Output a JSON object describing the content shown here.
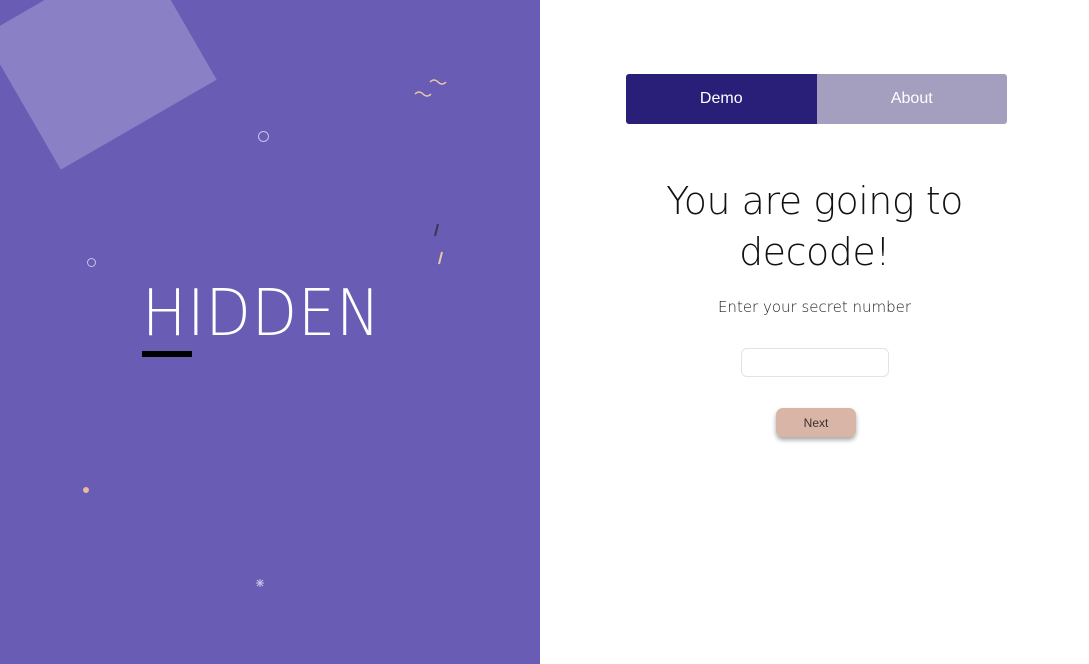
{
  "brand": {
    "title": "HIDDEN"
  },
  "tabs": [
    {
      "label": "Demo",
      "active": true
    },
    {
      "label": "About",
      "active": false
    }
  ],
  "main": {
    "heading_line1": "You are going to",
    "heading_line2": "decode!",
    "subtitle": "Enter your secret number",
    "secret_input_value": "",
    "secret_input_placeholder": "",
    "next_label": "Next"
  },
  "colors": {
    "left_panel_bg": "#685cb5",
    "tab_active_bg": "#2a1f78",
    "tab_inactive_bg": "#a59fbf",
    "next_button_bg": "#d9b5a8",
    "accent_peach": "#e7b9a0"
  }
}
